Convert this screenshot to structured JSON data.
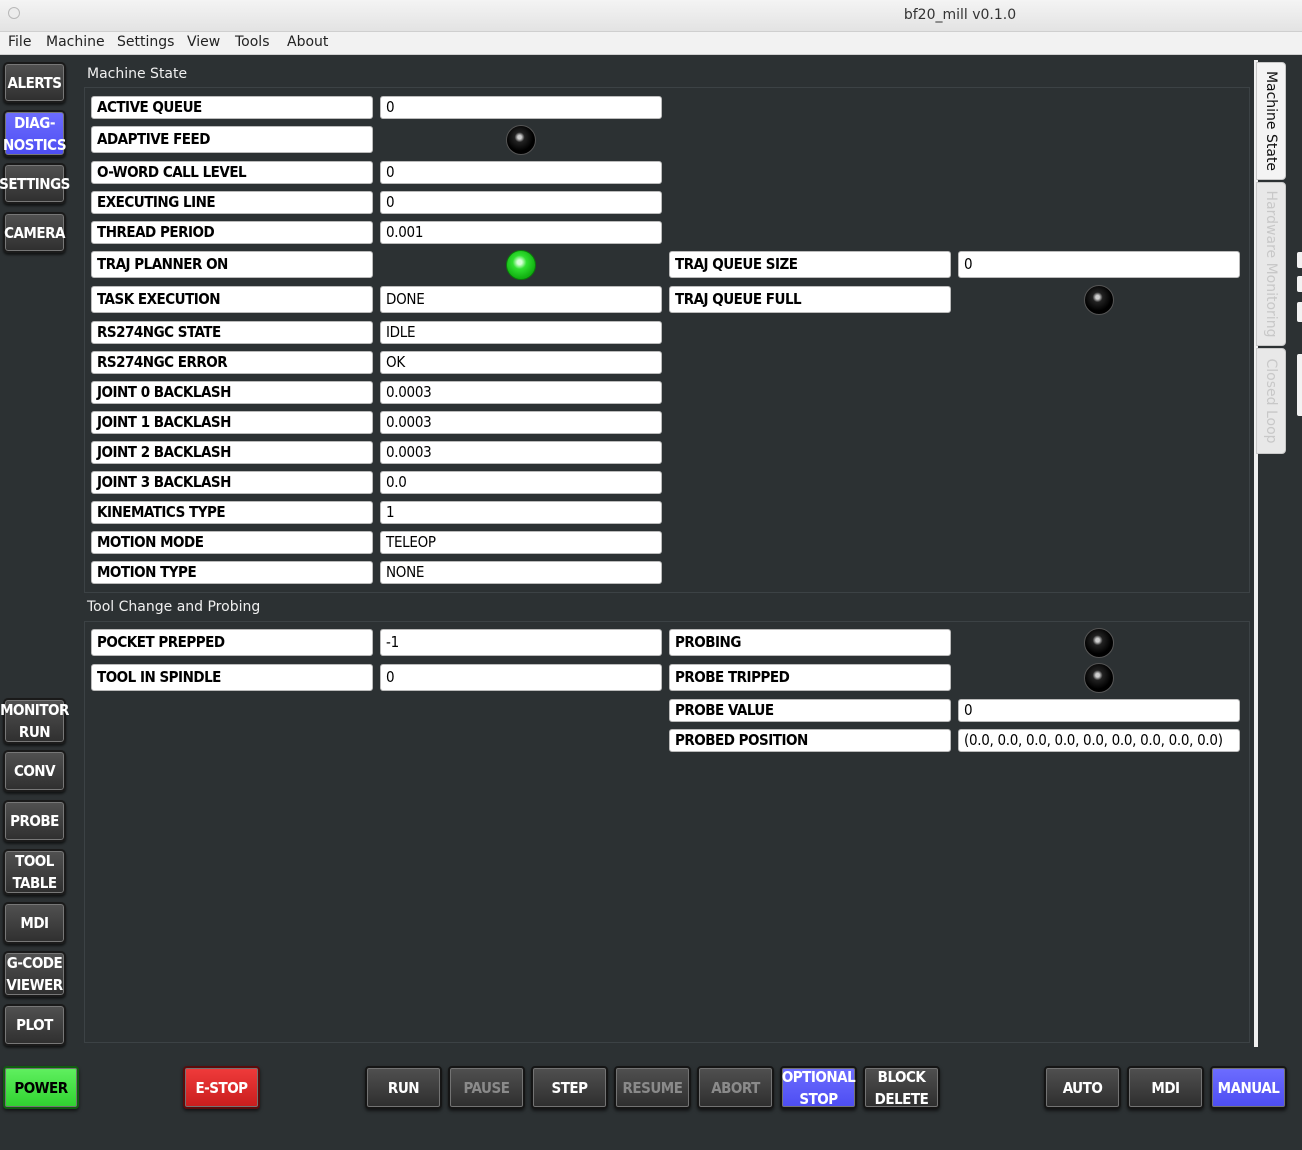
{
  "window": {
    "title": "bf20_mill v0.1.0"
  },
  "menu": [
    "File",
    "Machine",
    "Settings",
    "View",
    "Tools",
    "About"
  ],
  "left_nav_top": [
    {
      "label": "ALERTS",
      "active": false
    },
    {
      "label": "DIAG-\nNOSTICS",
      "active": true
    },
    {
      "label": "SETTINGS",
      "active": false
    },
    {
      "label": "CAMERA",
      "active": false
    }
  ],
  "left_nav_bottom": [
    {
      "label": "MONITOR\nRUN"
    },
    {
      "label": "CONV"
    },
    {
      "label": "PROBE"
    },
    {
      "label": "TOOL\nTABLE"
    },
    {
      "label": "MDI"
    },
    {
      "label": "G-CODE\nVIEWER"
    },
    {
      "label": "PLOT"
    }
  ],
  "machine_state": {
    "title": "Machine State",
    "rows": [
      {
        "label": "ACTIVE QUEUE",
        "value": "0"
      },
      {
        "label": "ADAPTIVE FEED",
        "led": "off"
      },
      {
        "label": "O-WORD CALL LEVEL",
        "value": "0"
      },
      {
        "label": "EXECUTING LINE",
        "value": "0"
      },
      {
        "label": "THREAD PERIOD",
        "value": "0.001"
      },
      {
        "label": "TRAJ PLANNER ON",
        "led": "on"
      },
      {
        "label": "TASK EXECUTION",
        "value": "DONE"
      },
      {
        "label": "RS274NGC STATE",
        "value": "IDLE"
      },
      {
        "label": "RS274NGC ERROR",
        "value": "OK"
      },
      {
        "label": "JOINT 0 BACKLASH",
        "value": "0.0003"
      },
      {
        "label": "JOINT 1 BACKLASH",
        "value": "0.0003"
      },
      {
        "label": "JOINT 2 BACKLASH",
        "value": "0.0003"
      },
      {
        "label": "JOINT 3 BACKLASH",
        "value": "0.0"
      },
      {
        "label": "KINEMATICS TYPE",
        "value": "1"
      },
      {
        "label": "MOTION MODE",
        "value": "TELEOP"
      },
      {
        "label": "MOTION TYPE",
        "value": "NONE"
      }
    ],
    "right_rows": [
      {
        "label": "TRAJ QUEUE SIZE",
        "value": "0"
      },
      {
        "label": "TRAJ QUEUE FULL",
        "led": "off"
      }
    ]
  },
  "tool_change": {
    "title": "Tool Change and Probing",
    "left_rows": [
      {
        "label": "POCKET PREPPED",
        "value": "-1"
      },
      {
        "label": "TOOL IN SPINDLE",
        "value": "0"
      }
    ],
    "right_rows": [
      {
        "label": "PROBING",
        "led": "off"
      },
      {
        "label": "PROBE TRIPPED",
        "led": "off"
      },
      {
        "label": "PROBE VALUE",
        "value": "0"
      },
      {
        "label": "PROBED POSITION",
        "value": "(0.0, 0.0, 0.0, 0.0, 0.0, 0.0, 0.0, 0.0, 0.0)"
      }
    ]
  },
  "side_tabs": [
    {
      "label": "Machine State",
      "active": true
    },
    {
      "label": "Hardware Monitoring",
      "active": false
    },
    {
      "label": "Closed Loop",
      "active": false
    }
  ],
  "bottom_bar": {
    "power": "POWER",
    "estop": "E-STOP",
    "program": [
      {
        "label": "RUN",
        "state": "normal"
      },
      {
        "label": "PAUSE",
        "state": "disabled"
      },
      {
        "label": "STEP",
        "state": "normal"
      },
      {
        "label": "RESUME",
        "state": "disabled"
      },
      {
        "label": "ABORT",
        "state": "disabled"
      },
      {
        "label": "OPTIONAL\nSTOP",
        "state": "active"
      },
      {
        "label": "BLOCK\nDELETE",
        "state": "normal"
      }
    ],
    "modes": [
      {
        "label": "AUTO",
        "state": "normal"
      },
      {
        "label": "MDI",
        "state": "normal"
      },
      {
        "label": "MANUAL",
        "state": "active"
      }
    ]
  },
  "colors": {
    "background": "#2c3133",
    "accent": "#5a5aff",
    "power": "#44e044",
    "estop": "#dd2a2a",
    "led_on": "#22cc22"
  }
}
